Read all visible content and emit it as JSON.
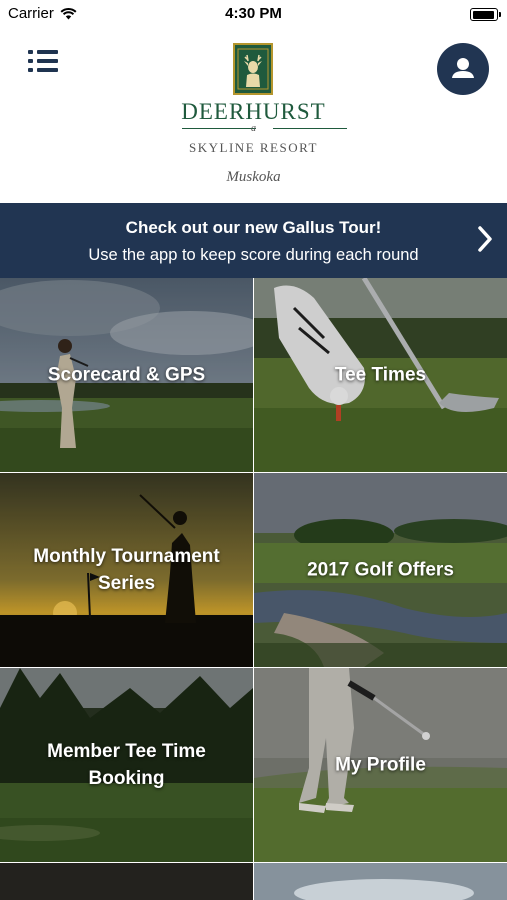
{
  "status_bar": {
    "carrier": "Carrier",
    "time": "4:30 PM",
    "battery_level": 0.95
  },
  "header": {
    "brand_name": "DEERHURST",
    "brand_connector": "a",
    "brand_sub": "SKYLINE RESORT",
    "brand_location": "Muskoka",
    "colors": {
      "brand_green": "#1f5a3d",
      "navy": "#213552"
    }
  },
  "banner": {
    "title": "Check out our new Gallus Tour!",
    "subtitle": "Use the app to keep score during each round"
  },
  "tiles": [
    {
      "label": "Scorecard & GPS"
    },
    {
      "label": "Tee Times"
    },
    {
      "label": "Monthly Tournament Series"
    },
    {
      "label": "2017 Golf Offers"
    },
    {
      "label": "Member Tee Time Booking"
    },
    {
      "label": "My Profile"
    }
  ]
}
